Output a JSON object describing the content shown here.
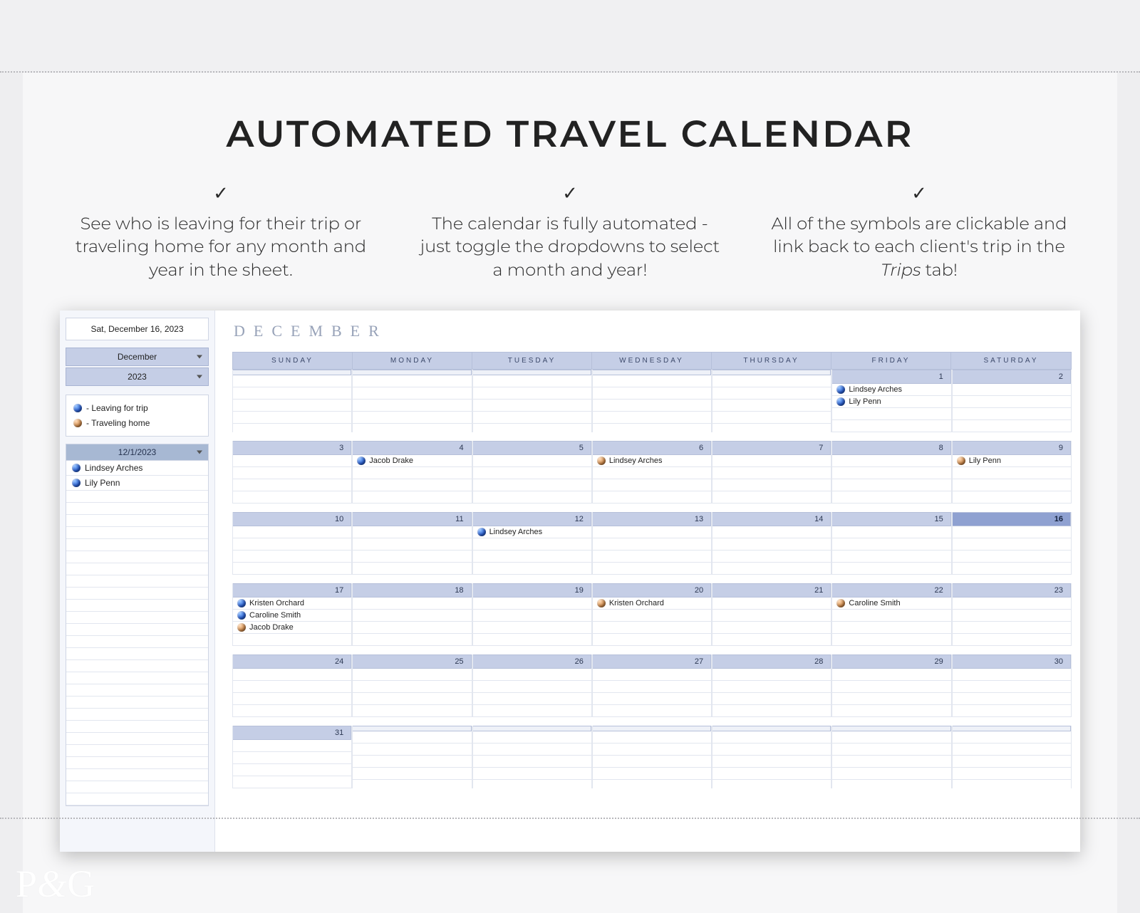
{
  "title": "AUTOMATED TRAVEL CALENDAR",
  "features": [
    "See who is leaving for their trip or traveling home for any month and year in the sheet.",
    "The calendar is fully automated - just toggle the dropdowns to select a month and year!",
    "All of the symbols are clickable and link back to each client's trip in the <em>Trips</em> tab!"
  ],
  "sidebar": {
    "today_display": "Sat, December 16, 2023",
    "month_select": "December",
    "year_select": "2023",
    "legend": {
      "leaving": "- Leaving for trip",
      "home": "- Traveling home"
    },
    "detail_date": "12/1/2023",
    "detail_entries": [
      {
        "icon": "globe",
        "name": "Lindsey Arches"
      },
      {
        "icon": "globe",
        "name": "Lily Penn"
      }
    ]
  },
  "calendar": {
    "month_title": "DECEMBER",
    "dow": [
      "SUNDAY",
      "MONDAY",
      "TUESDAY",
      "WEDNESDAY",
      "THURSDAY",
      "FRIDAY",
      "SATURDAY"
    ],
    "today_num": 16,
    "weeks": [
      [
        {
          "n": null,
          "e": []
        },
        {
          "n": null,
          "e": []
        },
        {
          "n": null,
          "e": []
        },
        {
          "n": null,
          "e": []
        },
        {
          "n": null,
          "e": []
        },
        {
          "n": 1,
          "e": [
            {
              "i": "globe",
              "t": "Lindsey Arches"
            },
            {
              "i": "globe",
              "t": "Lily Penn"
            }
          ]
        },
        {
          "n": 2,
          "e": []
        }
      ],
      [
        {
          "n": 3,
          "e": []
        },
        {
          "n": 4,
          "e": [
            {
              "i": "globe",
              "t": "Jacob Drake"
            }
          ]
        },
        {
          "n": 5,
          "e": []
        },
        {
          "n": 6,
          "e": [
            {
              "i": "home",
              "t": "Lindsey Arches"
            }
          ]
        },
        {
          "n": 7,
          "e": []
        },
        {
          "n": 8,
          "e": []
        },
        {
          "n": 9,
          "e": [
            {
              "i": "home",
              "t": "Lily Penn"
            }
          ]
        }
      ],
      [
        {
          "n": 10,
          "e": []
        },
        {
          "n": 11,
          "e": []
        },
        {
          "n": 12,
          "e": [
            {
              "i": "globe",
              "t": "Lindsey Arches"
            }
          ]
        },
        {
          "n": 13,
          "e": []
        },
        {
          "n": 14,
          "e": []
        },
        {
          "n": 15,
          "e": []
        },
        {
          "n": 16,
          "e": []
        }
      ],
      [
        {
          "n": 17,
          "e": [
            {
              "i": "globe",
              "t": "Kristen Orchard"
            },
            {
              "i": "globe",
              "t": "Caroline Smith"
            },
            {
              "i": "home",
              "t": "Jacob Drake"
            }
          ]
        },
        {
          "n": 18,
          "e": []
        },
        {
          "n": 19,
          "e": []
        },
        {
          "n": 20,
          "e": [
            {
              "i": "home",
              "t": "Kristen Orchard"
            }
          ]
        },
        {
          "n": 21,
          "e": []
        },
        {
          "n": 22,
          "e": [
            {
              "i": "home",
              "t": "Caroline Smith"
            }
          ]
        },
        {
          "n": 23,
          "e": []
        }
      ],
      [
        {
          "n": 24,
          "e": []
        },
        {
          "n": 25,
          "e": []
        },
        {
          "n": 26,
          "e": []
        },
        {
          "n": 27,
          "e": []
        },
        {
          "n": 28,
          "e": []
        },
        {
          "n": 29,
          "e": []
        },
        {
          "n": 30,
          "e": []
        }
      ],
      [
        {
          "n": 31,
          "e": []
        },
        {
          "n": null,
          "e": []
        },
        {
          "n": null,
          "e": []
        },
        {
          "n": null,
          "e": []
        },
        {
          "n": null,
          "e": []
        },
        {
          "n": null,
          "e": []
        },
        {
          "n": null,
          "e": []
        }
      ]
    ]
  },
  "logo": "P&G"
}
